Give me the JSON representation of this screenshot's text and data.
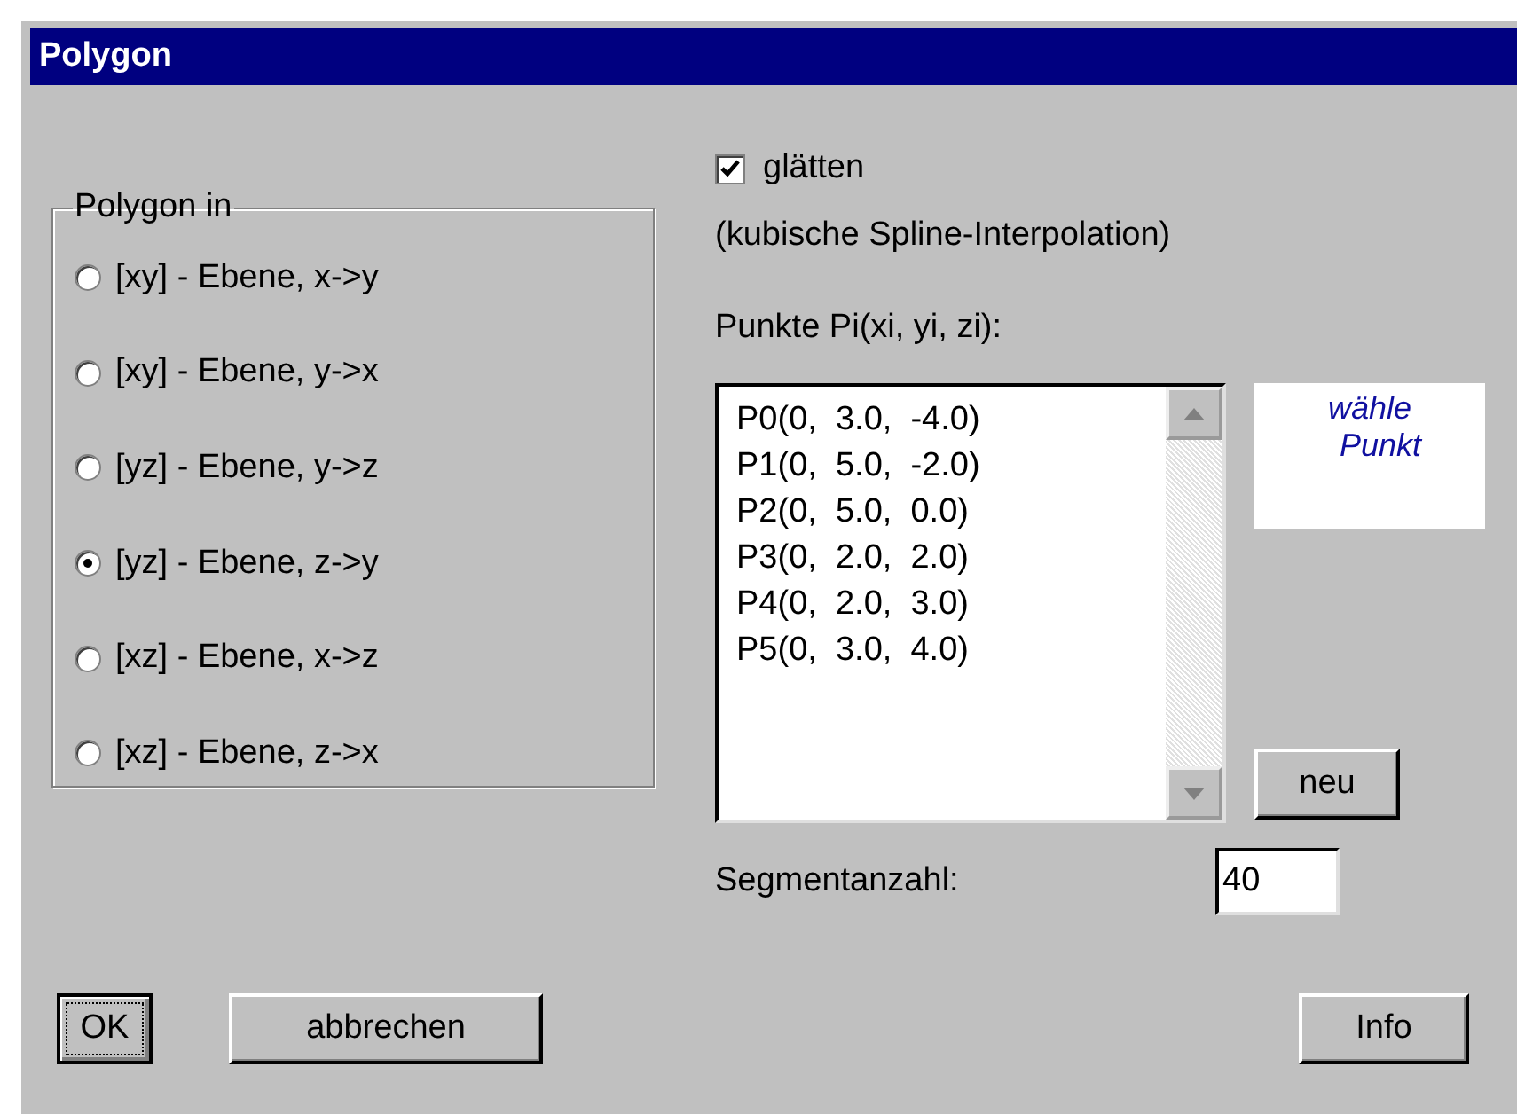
{
  "window": {
    "title": "Polygon"
  },
  "plane_group": {
    "label": "Polygon in",
    "options": [
      {
        "label": "[xy] - Ebene, x->y",
        "selected": false
      },
      {
        "label": "[xy] - Ebene, y->x",
        "selected": false
      },
      {
        "label": "[yz] - Ebene, y->z",
        "selected": false
      },
      {
        "label": "[yz] - Ebene, z->y",
        "selected": true
      },
      {
        "label": "[xz] - Ebene, x->z",
        "selected": false
      },
      {
        "label": "[xz] - Ebene, z->x",
        "selected": false
      }
    ]
  },
  "smooth": {
    "label": "glätten",
    "checked": true,
    "note": "(kubische Spline-Interpolation)"
  },
  "points": {
    "label": "Punkte Pi(xi, yi, zi):",
    "items": [
      "P0(0,  3.0,  -4.0)",
      "P1(0,  5.0,  -2.0)",
      "P2(0,  5.0,  0.0)",
      "P3(0,  2.0,  2.0)",
      "P4(0,  2.0,  3.0)",
      "P5(0,  3.0,  4.0)"
    ],
    "hint": [
      "wähle",
      "Punkt"
    ],
    "new_button": "neu"
  },
  "segments": {
    "label": "Segmentanzahl:",
    "value": "40"
  },
  "buttons": [
    {
      "label": "OK",
      "focused": true
    },
    {
      "label": "abbrechen",
      "focused": false
    },
    {
      "label": "Info",
      "focused": false
    }
  ]
}
